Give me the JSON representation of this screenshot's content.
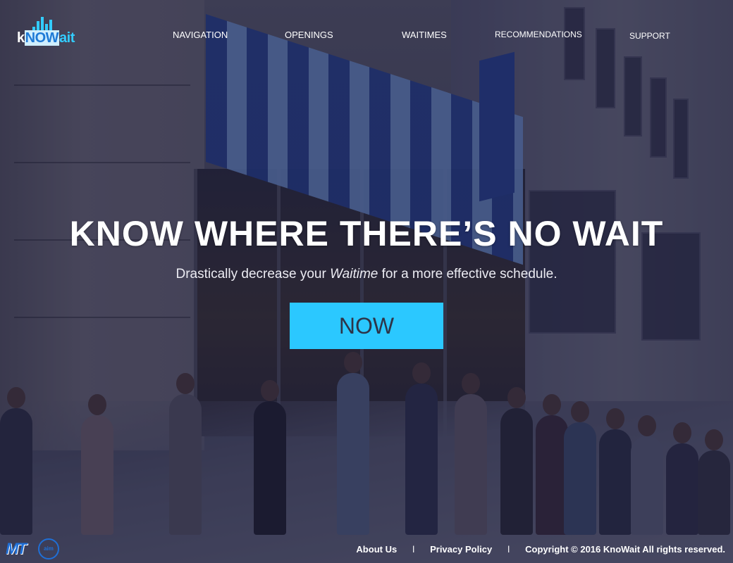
{
  "brand": {
    "logo_prefix": "k",
    "logo_now": "NOW",
    "logo_suffix": "ait"
  },
  "nav": {
    "items": [
      {
        "label": "NAVIGATION"
      },
      {
        "label": "OPENINGS"
      },
      {
        "label": "WAITIMES"
      },
      {
        "label": "RECOMMENDATIONS"
      },
      {
        "label": "SUPPORT"
      }
    ]
  },
  "hero": {
    "title": "KNOW WHERE THERE’S NO WAIT",
    "subtitle_before": "Drastically decrease your ",
    "subtitle_emphasis": "Waitime",
    "subtitle_after": " for a more effective schedule.",
    "cta_label": "NOW"
  },
  "footer": {
    "logo_left": "MT",
    "logo_right": "aim",
    "about": "About Us",
    "separator": "l",
    "privacy": "Privacy Policy",
    "copyright": "Copyright © 2016 KnoWait All rights reserved."
  },
  "colors": {
    "accent": "#2bc8ff",
    "cta_text": "#2d3448",
    "overlay": "#16163c"
  },
  "icons": [
    "equalizer-logo-icon",
    "mt-logo-icon",
    "aim-logo-icon"
  ]
}
